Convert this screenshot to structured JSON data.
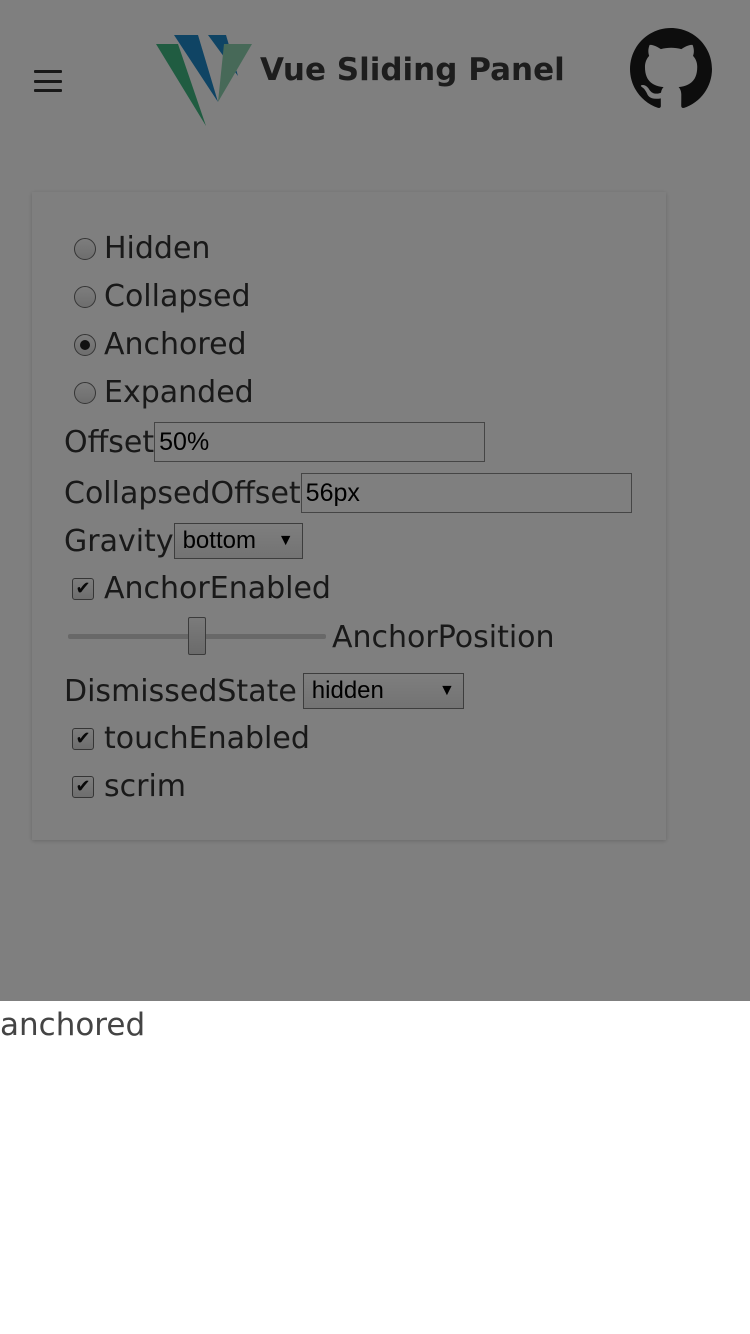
{
  "header": {
    "title": "Vue Sliding Panel",
    "menu_icon": "hamburger-menu-icon",
    "logo_icon": "vue-sliding-panel-logo",
    "github_icon": "github-icon",
    "logo_colors": [
      "#41b883",
      "#1e88c9",
      "#8fd3b1"
    ]
  },
  "controls": {
    "state_options": [
      {
        "label": "Hidden",
        "checked": false
      },
      {
        "label": "Collapsed",
        "checked": false
      },
      {
        "label": "Anchored",
        "checked": true
      },
      {
        "label": "Expanded",
        "checked": false
      }
    ],
    "offset": {
      "label": "Offset",
      "value": "50%"
    },
    "collapsed_offset": {
      "label": "CollapsedOffset",
      "value": "56px"
    },
    "gravity": {
      "label": "Gravity",
      "value": "bottom"
    },
    "anchor_enabled": {
      "label": "AnchorEnabled",
      "checked": true
    },
    "anchor_position": {
      "label": "AnchorPosition",
      "fraction": 0.5
    },
    "dismissed_state": {
      "label": "DismissedState",
      "value": "hidden"
    },
    "touch_enabled": {
      "label": "touchEnabled",
      "checked": true
    },
    "scrim": {
      "label": "scrim",
      "checked": true
    }
  },
  "panel": {
    "state_text": "anchored"
  }
}
